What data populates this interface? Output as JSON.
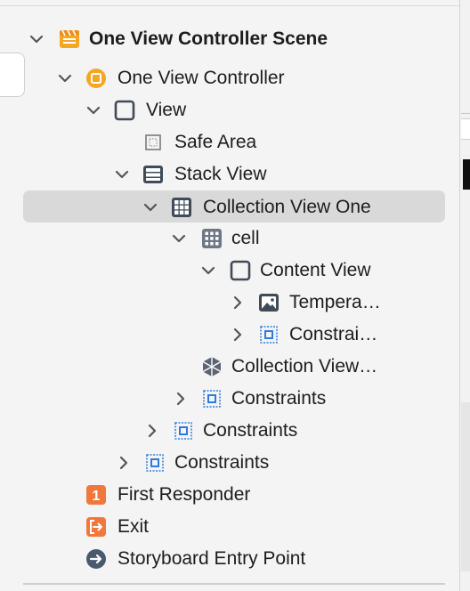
{
  "outline": {
    "items": [
      {
        "label": "One View Controller Scene"
      },
      {
        "label": "One View Controller"
      },
      {
        "label": "View"
      },
      {
        "label": "Safe Area"
      },
      {
        "label": "Stack View"
      },
      {
        "label": "Collection View One"
      },
      {
        "label": "cell"
      },
      {
        "label": "Content View"
      },
      {
        "label": "Tempera…"
      },
      {
        "label": "Constrai…"
      },
      {
        "label": "Collection View…"
      },
      {
        "label": "Constraints"
      },
      {
        "label": "Constraints"
      },
      {
        "label": "Constraints"
      },
      {
        "label": "First Responder",
        "badge": "1"
      },
      {
        "label": "Exit"
      },
      {
        "label": "Storyboard Entry Point"
      }
    ]
  },
  "colors": {
    "scene": "#f5a623",
    "controller": "#f5a623",
    "first_responder": "#f0783c",
    "exit": "#f0783c",
    "entry_point": "#4a5a6e",
    "view_icon": "#404a58",
    "constraint_icon": "#2f7bdc",
    "selection": "#d9d9d9"
  },
  "icons": [
    "chevron-down-icon",
    "chevron-right-icon",
    "scene-icon",
    "view-controller-icon",
    "view-icon",
    "safe-area-icon",
    "stack-view-icon",
    "collection-view-icon",
    "cell-icon",
    "image-view-icon",
    "constraints-icon",
    "flow-layout-icon",
    "first-responder-icon",
    "exit-icon",
    "entry-point-icon"
  ]
}
